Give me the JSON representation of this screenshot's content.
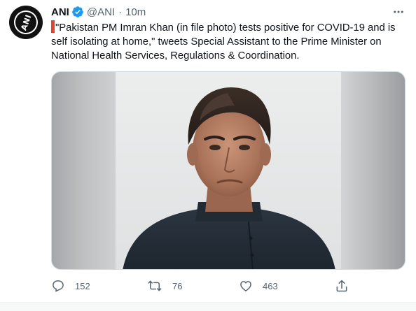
{
  "author": {
    "name": "ANI",
    "handle": "@ANI",
    "separator": "·",
    "time": "10m",
    "verified": true,
    "avatar_logo_text": "ANI"
  },
  "tweet": {
    "text": "\"Pakistan PM Imran Khan (in file photo) tests positive for COVID-19 and is self isolating at home,\" tweets Special Assistant to the Prime Minister on National Health Services, Regulations & Coordination."
  },
  "actions": {
    "reply_count": "152",
    "retweet_count": "76",
    "like_count": "463"
  },
  "icons": {
    "more": "more-horizontal-icon",
    "verified": "verified-badge-icon",
    "reply": "reply-icon",
    "retweet": "retweet-icon",
    "like": "heart-icon",
    "share": "share-icon"
  },
  "colors": {
    "text": "#0f1419",
    "muted": "#536471",
    "verified": "#1d9bf0",
    "quote_accent": "#e0452f"
  }
}
